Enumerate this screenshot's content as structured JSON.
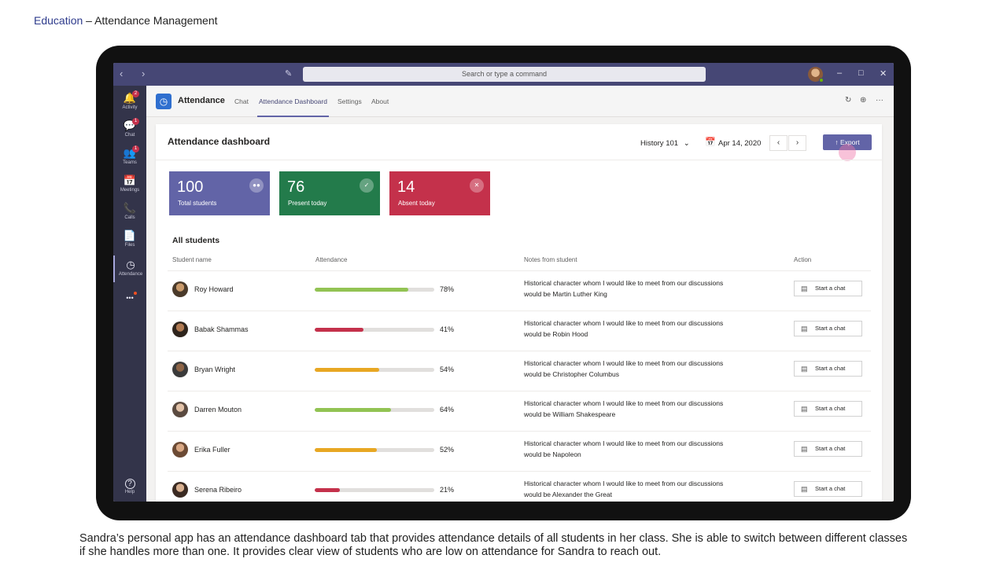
{
  "slide": {
    "crumb": "Education",
    "sep": " – ",
    "title": "Attendance Management",
    "caption": "Sandra’s personal app has an attendance  dashboard tab that provides attendance  details of all students  in her class. She is able to switch between different classes if she handles more than one. It provides clear view of students  who are low on attendance  for Sandra to reach out."
  },
  "titlebar": {
    "search_placeholder": "Search or type a command",
    "nav": "‹ ›",
    "compose_icon": "✎",
    "minimize": "–",
    "maximize": "□",
    "close": "✕"
  },
  "rail": {
    "items": [
      {
        "label": "Activity",
        "icon": "🔔",
        "badge": "2"
      },
      {
        "label": "Chat",
        "icon": "💬",
        "badge": "1"
      },
      {
        "label": "Teams",
        "icon": "👥",
        "badge": "1"
      },
      {
        "label": "Meetings",
        "icon": "📅"
      },
      {
        "label": "Calls",
        "icon": "📞"
      },
      {
        "label": "Files",
        "icon": "📄"
      },
      {
        "label": "Attendance",
        "icon": "◷"
      },
      {
        "label": "",
        "icon": "•••"
      }
    ],
    "help_label": "Help",
    "help_icon": "?"
  },
  "app": {
    "name": "Attendance",
    "tabs": [
      "Chat",
      "Attendance Dashboard",
      "Settings",
      "About"
    ],
    "active_tab": "Attendance Dashboard",
    "refresh_icon": "↻",
    "globe_icon": "⊕",
    "more_icon": "···"
  },
  "dashboard": {
    "title": "Attendance dashboard",
    "class_select": "History 101",
    "date": "Apr 14, 2020",
    "prev": "‹",
    "next": "›",
    "export_label": "Export",
    "tiles": [
      {
        "value": "100",
        "label": "Total students",
        "color": "#6264a7"
      },
      {
        "value": "76",
        "label": "Present today",
        "color": "#237b4b"
      },
      {
        "value": "14",
        "label": "Absent today",
        "color": "#c4314b"
      }
    ],
    "section_title": "All students",
    "columns": [
      "Student name",
      "Attendance",
      "Notes from student",
      "Action"
    ],
    "action_label": "Start a chat",
    "students": [
      {
        "name": "Roy Howard",
        "attendance": 78,
        "pct": "78%",
        "color": "#92c353",
        "note": "Historical character whom I would like to meet from our discussions would be Martin Luther King"
      },
      {
        "name": "Babak Shammas",
        "attendance": 41,
        "pct": "41%",
        "color": "#c4314b",
        "note": "Historical character whom I would like to meet from our discussions would be Robin Hood"
      },
      {
        "name": "Bryan Wright",
        "attendance": 54,
        "pct": "54%",
        "color": "#e8a723",
        "note": "Historical character whom I would like to meet from our discussions would be Christopher Columbus"
      },
      {
        "name": "Darren Mouton",
        "attendance": 64,
        "pct": "64%",
        "color": "#92c353",
        "note": "Historical character whom I would like to meet from our discussions would be William Shakespeare"
      },
      {
        "name": "Erika Fuller",
        "attendance": 52,
        "pct": "52%",
        "color": "#e8a723",
        "note": "Historical character whom I would like to meet from our discussions would be Napoleon"
      },
      {
        "name": "Serena Ribeiro",
        "attendance": 21,
        "pct": "21%",
        "color": "#c4314b",
        "note": "Historical character whom I would like to meet from our discussions would be Alexander the Great"
      }
    ]
  }
}
